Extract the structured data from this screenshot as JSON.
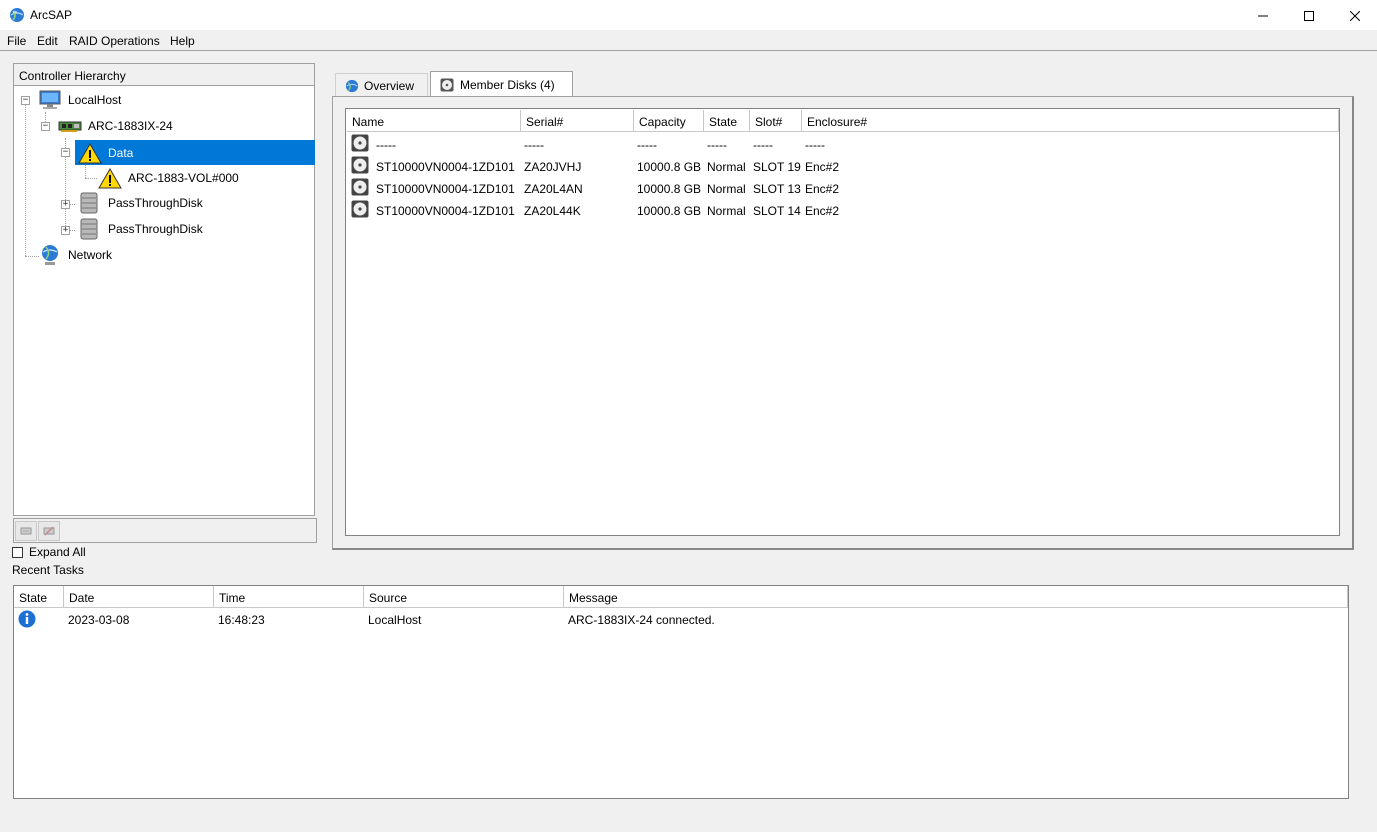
{
  "window": {
    "title": "ArcSAP"
  },
  "menu": [
    "File",
    "Edit",
    "RAID Operations",
    "Help"
  ],
  "tree": {
    "header": "Controller Hierarchy",
    "nodes": {
      "localhost": "LocalHost",
      "controller": "ARC-1883IX-24",
      "raidset": "Data",
      "volume": "ARC-1883-VOL#000",
      "passthrough1": "PassThroughDisk",
      "passthrough2": "PassThroughDisk",
      "network": "Network"
    },
    "expand_all": "Expand All"
  },
  "tabs": {
    "overview": "Overview",
    "members": "Member Disks (4)"
  },
  "member_disks": {
    "columns": [
      "Name",
      "Serial#",
      "Capacity",
      "State",
      "Slot#",
      "Enclosure#"
    ],
    "rows": [
      [
        "-----",
        "-----",
        "-----",
        "-----",
        "-----",
        "-----"
      ],
      [
        "ST10000VN0004-1ZD101",
        "ZA20JVHJ",
        "10000.8 GB",
        "Normal",
        "SLOT 19",
        "Enc#2"
      ],
      [
        "ST10000VN0004-1ZD101",
        "ZA20L4AN",
        "10000.8 GB",
        "Normal",
        "SLOT 13",
        "Enc#2"
      ],
      [
        "ST10000VN0004-1ZD101",
        "ZA20L44K",
        "10000.8 GB",
        "Normal",
        "SLOT 14",
        "Enc#2"
      ]
    ]
  },
  "recent_tasks": {
    "label": "Recent Tasks",
    "columns": [
      "State",
      "Date",
      "Time",
      "Source",
      "Message"
    ],
    "rows": [
      {
        "state_icon": "info-icon",
        "date": "2023-03-08",
        "time": "16:48:23",
        "source": "LocalHost",
        "message": "ARC-1883IX-24 connected."
      }
    ]
  },
  "colors": {
    "selection": "#0078d7",
    "warning": "#ffd800"
  }
}
